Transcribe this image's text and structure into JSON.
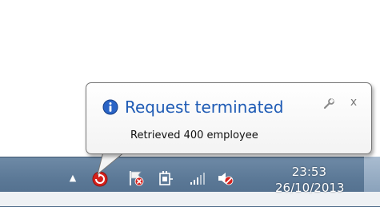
{
  "notification": {
    "title": "Request terminated",
    "message": "Retrieved 400 employee",
    "icon": "info-icon",
    "close_glyph": "x"
  },
  "tray": {
    "overflow_glyph": "▲",
    "icons": [
      "app-error-icon",
      "action-center-flag-icon",
      "power-plug-icon",
      "network-signal-icon",
      "volume-muted-icon"
    ]
  },
  "clock": {
    "time": "23:53",
    "date": "26/10/2013"
  },
  "colors": {
    "title": "#1e5bb5",
    "taskbar": "#5b7896",
    "error": "#d6211c"
  }
}
